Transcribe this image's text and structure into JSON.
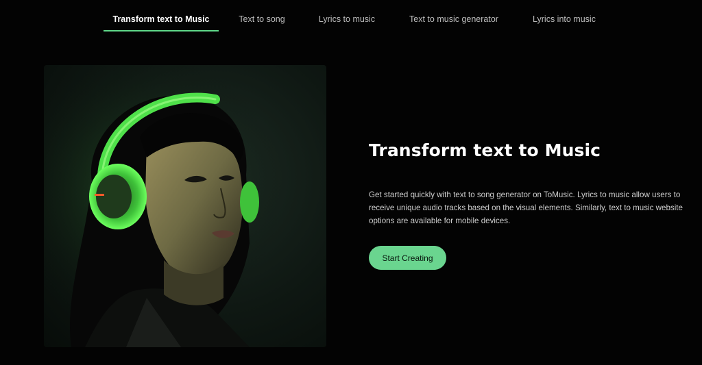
{
  "tabs": [
    {
      "label": "Transform text to Music",
      "active": true
    },
    {
      "label": "Text to song",
      "active": false
    },
    {
      "label": "Lyrics to music",
      "active": false
    },
    {
      "label": "Text to music generator",
      "active": false
    },
    {
      "label": "Lyrics into music",
      "active": false
    }
  ],
  "hero": {
    "headline": "Transform text to Music",
    "description": "Get started quickly with text to song generator on ToMusic. Lyrics to music allow users to receive unique audio tracks based on the visual elements. Similarly, text to music website options are available for mobile devices.",
    "cta_label": "Start Creating",
    "image_subject": "woman-with-green-headphones"
  },
  "colors": {
    "background": "#030303",
    "accent": "#6ad58f",
    "active_underline": "#5fd98a",
    "headphones_green": "#4fe04a"
  }
}
